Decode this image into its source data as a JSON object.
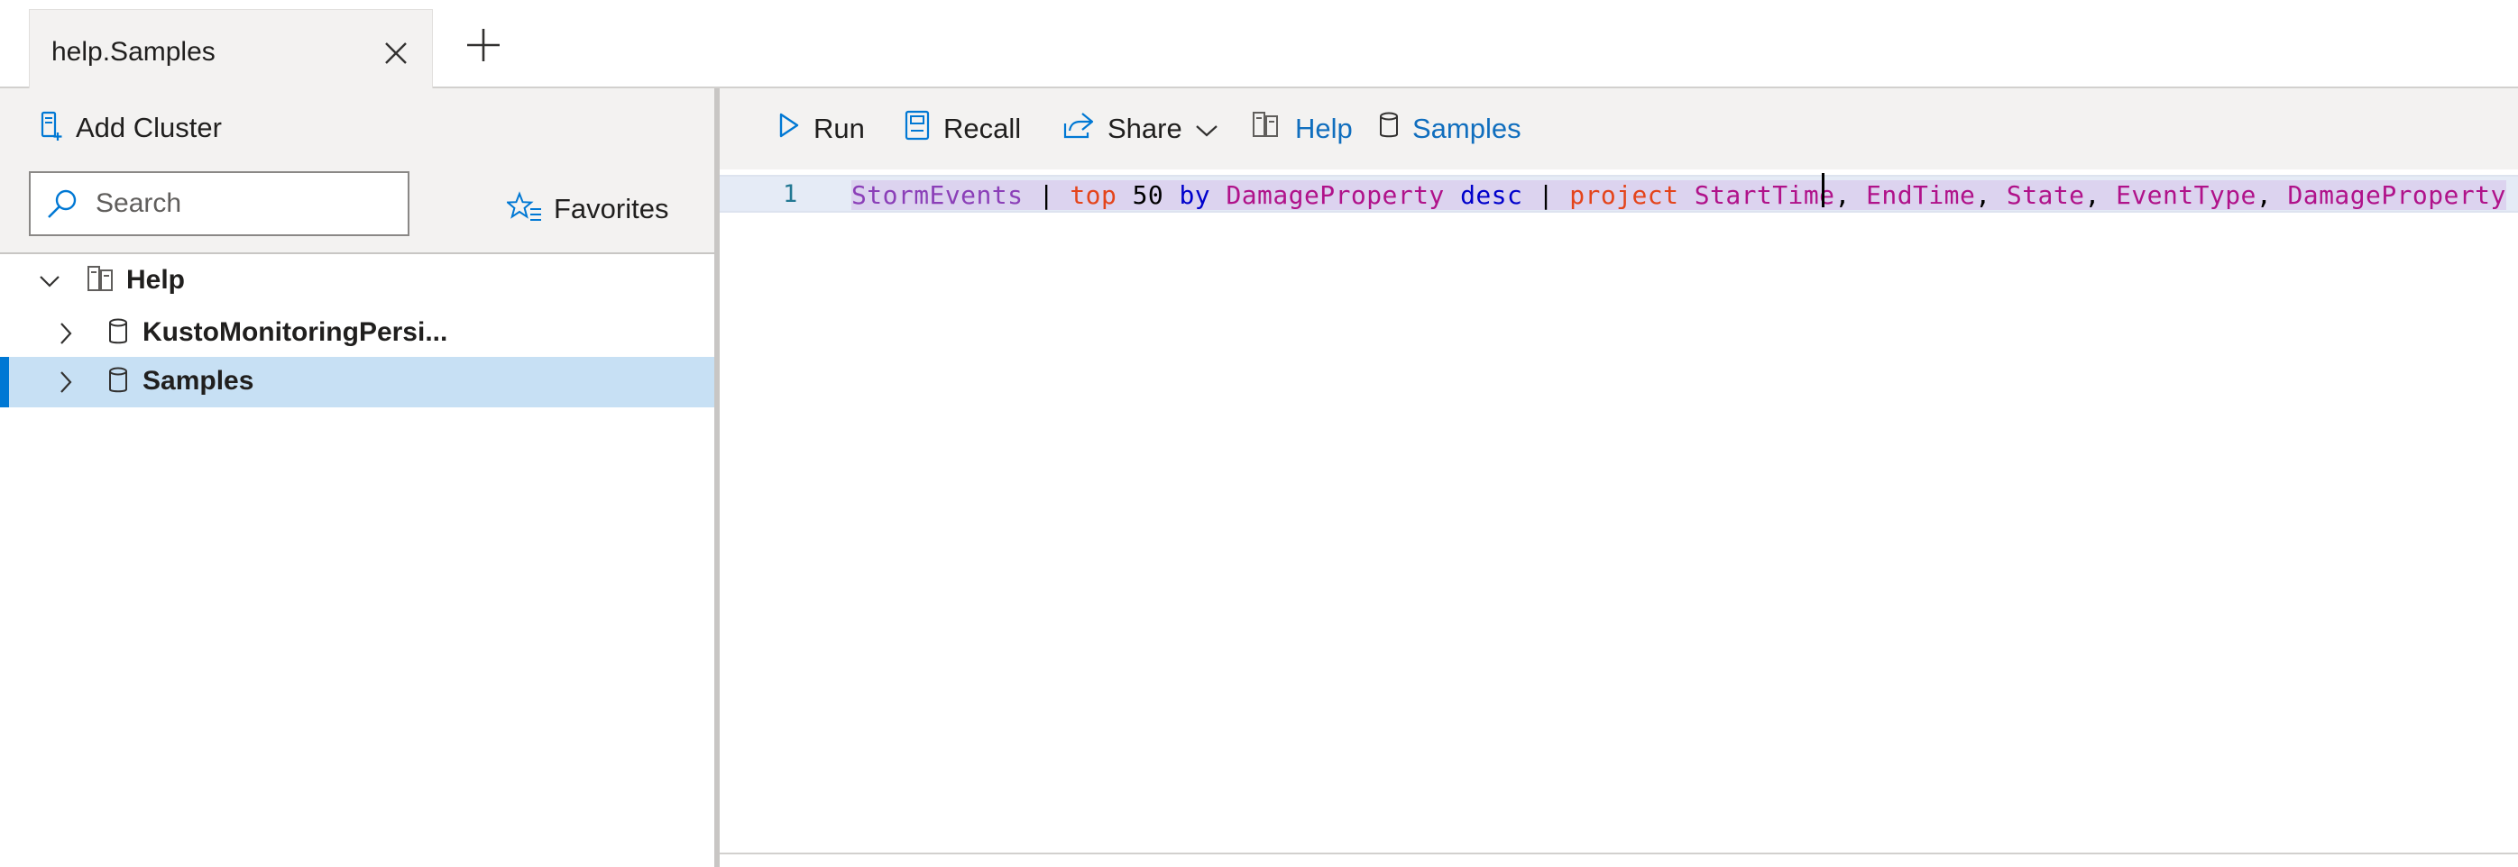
{
  "tabs": [
    {
      "label": "help.Samples",
      "close_icon": "close-icon"
    }
  ],
  "new_tab_icon": "plus-icon",
  "left_pane": {
    "add_cluster_label": "Add Cluster",
    "search_placeholder": "Search",
    "favorites_label": "Favorites",
    "tree": [
      {
        "label": "Help",
        "level": 0,
        "expanded": true,
        "icon": "cluster-icon"
      },
      {
        "label": "KustoMonitoringPersi...",
        "level": 1,
        "expanded": false,
        "icon": "database-icon"
      },
      {
        "label": "Samples",
        "level": 1,
        "expanded": false,
        "icon": "database-icon",
        "selected": true
      }
    ]
  },
  "toolbar": {
    "run_label": "Run",
    "recall_label": "Recall",
    "share_label": "Share",
    "help_label": "Help",
    "samples_label": "Samples"
  },
  "editor": {
    "line_number": "1",
    "tokens": [
      {
        "text": "StormEvents",
        "color": "#8b3fb8"
      },
      {
        "text": " | ",
        "color": "#000000"
      },
      {
        "text": "top",
        "color": "#e4441b"
      },
      {
        "text": " 50 ",
        "color": "#000000"
      },
      {
        "text": "by",
        "color": "#0000cc"
      },
      {
        "text": " ",
        "color": "#000000"
      },
      {
        "text": "DamageProperty",
        "color": "#b0128a"
      },
      {
        "text": " ",
        "color": "#000000"
      },
      {
        "text": "desc",
        "color": "#0000cc"
      },
      {
        "text": " | ",
        "color": "#000000"
      },
      {
        "text": "project",
        "color": "#e4441b"
      },
      {
        "text": " ",
        "color": "#000000"
      },
      {
        "text": "StartTime",
        "color": "#b0128a"
      },
      {
        "text": ", ",
        "color": "#000000"
      },
      {
        "text": "EndTime",
        "color": "#b0128a"
      },
      {
        "text": ", ",
        "color": "#000000"
      },
      {
        "text": "State",
        "color": "#b0128a"
      },
      {
        "text": ", ",
        "color": "#000000"
      },
      {
        "text": "EventType",
        "color": "#b0128a"
      },
      {
        "text": ", ",
        "color": "#000000"
      },
      {
        "text": "DamageProperty",
        "color": "#b0128a"
      }
    ]
  },
  "colors": {
    "accent": "#0078d4",
    "selection": "#c7e0f4",
    "link_blue": "#106ebe"
  }
}
